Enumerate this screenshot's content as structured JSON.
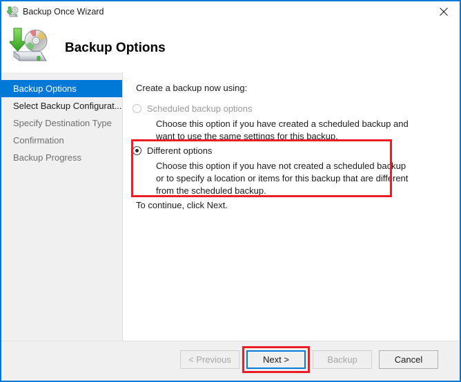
{
  "window": {
    "title": "Backup Once Wizard",
    "accent_color": "#0078d7",
    "annotation_color": "#ee1c25",
    "close_label": "Close"
  },
  "header": {
    "title": "Backup Options",
    "icon": "backup-drive-disc-icon"
  },
  "sidebar": {
    "items": [
      {
        "label": "Backup Options",
        "state": "current"
      },
      {
        "label": "Select Backup Configurat...",
        "state": "visited"
      },
      {
        "label": "Specify Destination Type",
        "state": "upcoming"
      },
      {
        "label": "Confirmation",
        "state": "upcoming"
      },
      {
        "label": "Backup Progress",
        "state": "upcoming"
      }
    ]
  },
  "main": {
    "prompt": "Create a backup now using:",
    "options": [
      {
        "id": "scheduled-backup-options",
        "label": "Scheduled backup options",
        "selected": false,
        "disabled": true,
        "description_lines": [
          "Choose this option if you have created a scheduled backup and",
          "want to use the same settings for this backup."
        ]
      },
      {
        "id": "different-options",
        "label": "Different options",
        "selected": true,
        "disabled": false,
        "highlighted": true,
        "description_lines": [
          "Choose this option if you have not created a scheduled backup",
          "or to specify a location or items for this backup that are different",
          "from the scheduled backup."
        ]
      }
    ],
    "continue_text": "To continue, click Next."
  },
  "footer": {
    "buttons": [
      {
        "label": "< Previous",
        "disabled": true,
        "focused": false,
        "highlighted": false
      },
      {
        "label": "Next >",
        "disabled": false,
        "focused": true,
        "highlighted": true
      },
      {
        "label": "Backup",
        "disabled": true,
        "focused": false,
        "highlighted": false
      },
      {
        "label": "Cancel",
        "disabled": false,
        "focused": false,
        "highlighted": false
      }
    ]
  }
}
